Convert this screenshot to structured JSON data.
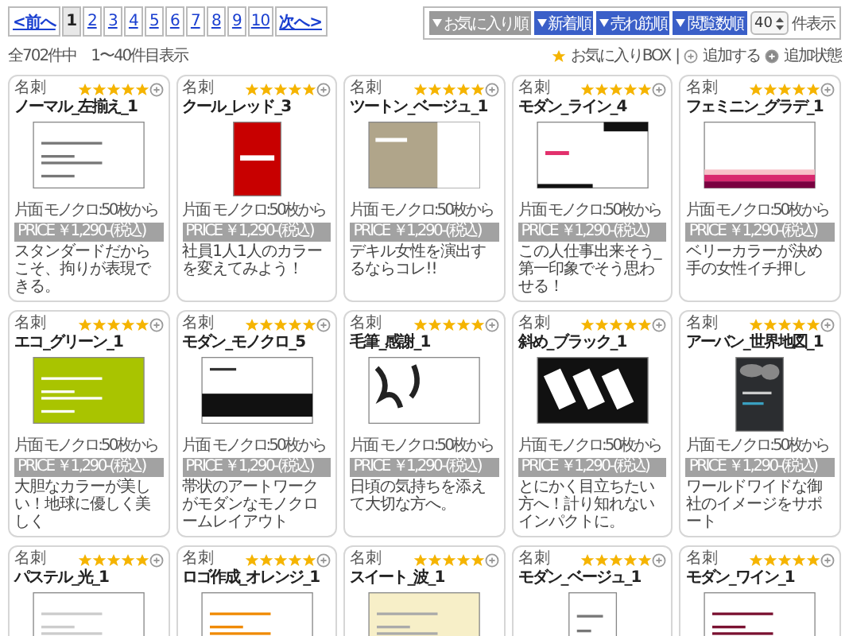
{
  "pagination": {
    "prev": "<前へ",
    "next": "次へ>",
    "pages": [
      {
        "label": "1",
        "selected": true
      },
      {
        "label": "2",
        "selected": false
      },
      {
        "label": "3",
        "selected": false
      },
      {
        "label": "4",
        "selected": false
      },
      {
        "label": "5",
        "selected": false
      },
      {
        "label": "6",
        "selected": false
      },
      {
        "label": "7",
        "selected": false
      },
      {
        "label": "8",
        "selected": false
      },
      {
        "label": "9",
        "selected": false
      },
      {
        "label": "10",
        "selected": false
      }
    ]
  },
  "result_count": "全702件中　1〜40件目表示",
  "sort": {
    "buttons": [
      {
        "label": "お気に入り順",
        "selected": true
      },
      {
        "label": "新着順",
        "selected": false
      },
      {
        "label": "売れ筋順",
        "selected": false
      },
      {
        "label": "閲覧数順",
        "selected": false
      }
    ],
    "per_page": "40",
    "per_page_label": "件表示"
  },
  "legend": {
    "favorites": "お気に入りBOX",
    "separator": "|",
    "add": "追加する",
    "added": "追加状態"
  },
  "cards": [
    {
      "category": "名刺",
      "stars": 5,
      "added": false,
      "title": "ノーマル_左揃え_1",
      "spec": "片面 モノクロ:50枚から",
      "price": "PRICE ￥1,290-(税込)",
      "description": "スタンダードだからこそ、拘りが表現できる。"
    },
    {
      "category": "名刺",
      "stars": 5,
      "added": false,
      "title": "クール_レッド_3",
      "spec": "片面 モノクロ:50枚から",
      "price": "PRICE ￥1,290-(税込)",
      "description": "社員1人1人のカラーを変えてみよう！"
    },
    {
      "category": "名刺",
      "stars": 5,
      "added": false,
      "title": "ツートン_ベージュ_1",
      "spec": "片面 モノクロ:50枚から",
      "price": "PRICE ￥1,290-(税込)",
      "description": "デキル女性を演出するならコレ!!"
    },
    {
      "category": "名刺",
      "stars": 5,
      "added": false,
      "title": "モダン_ライン_4",
      "spec": "片面 モノクロ:50枚から",
      "price": "PRICE ￥1,290-(税込)",
      "description": "この人仕事出来そう_第一印象でそう思わせる！"
    },
    {
      "category": "名刺",
      "stars": 5,
      "added": false,
      "title": "フェミニン_グラデ_1",
      "spec": "片面 モノクロ:50枚から",
      "price": "PRICE ￥1,290-(税込)",
      "description": "ベリーカラーが決め手の女性イチ押し"
    },
    {
      "category": "名刺",
      "stars": 5,
      "added": false,
      "title": "エコ_グリーン_1",
      "spec": "片面 モノクロ:50枚から",
      "price": "PRICE ￥1,290-(税込)",
      "description": "大胆なカラーが美しい！地球に優しく美しく"
    },
    {
      "category": "名刺",
      "stars": 5,
      "added": false,
      "title": "モダン_モノクロ_5",
      "spec": "片面 モノクロ:50枚から",
      "price": "PRICE ￥1,290-(税込)",
      "description": "帯状のアートワークがモダンなモノクロームレイアウト"
    },
    {
      "category": "名刺",
      "stars": 5,
      "added": false,
      "title": "毛筆_感謝_1",
      "spec": "片面 モノクロ:50枚から",
      "price": "PRICE ￥1,290-(税込)",
      "description": "日頃の気持ちを添えて大切な方へ。"
    },
    {
      "category": "名刺",
      "stars": 5,
      "added": false,
      "title": "斜め_ブラック_1",
      "spec": "片面 モノクロ:50枚から",
      "price": "PRICE ￥1,290-(税込)",
      "description": "とにかく目立ちたい方へ！計り知れないインパクトに。"
    },
    {
      "category": "名刺",
      "stars": 5,
      "added": false,
      "title": "アーバン_世界地図_1",
      "spec": "片面 モノクロ:50枚から",
      "price": "PRICE ￥1,290-(税込)",
      "description": "ワールドワイドな御社のイメージをサポート"
    },
    {
      "category": "名刺",
      "stars": 5,
      "added": false,
      "title": "パステル_光_1"
    },
    {
      "category": "名刺",
      "stars": 5,
      "added": false,
      "title": "ロゴ作成_オレンジ_1"
    },
    {
      "category": "名刺",
      "stars": 5,
      "added": false,
      "title": "スイート_波_1"
    },
    {
      "category": "名刺",
      "stars": 5,
      "added": false,
      "title": "モダン_ベージュ_1"
    },
    {
      "category": "名刺",
      "stars": 5,
      "added": false,
      "title": "モダン_ワイン_1"
    }
  ]
}
